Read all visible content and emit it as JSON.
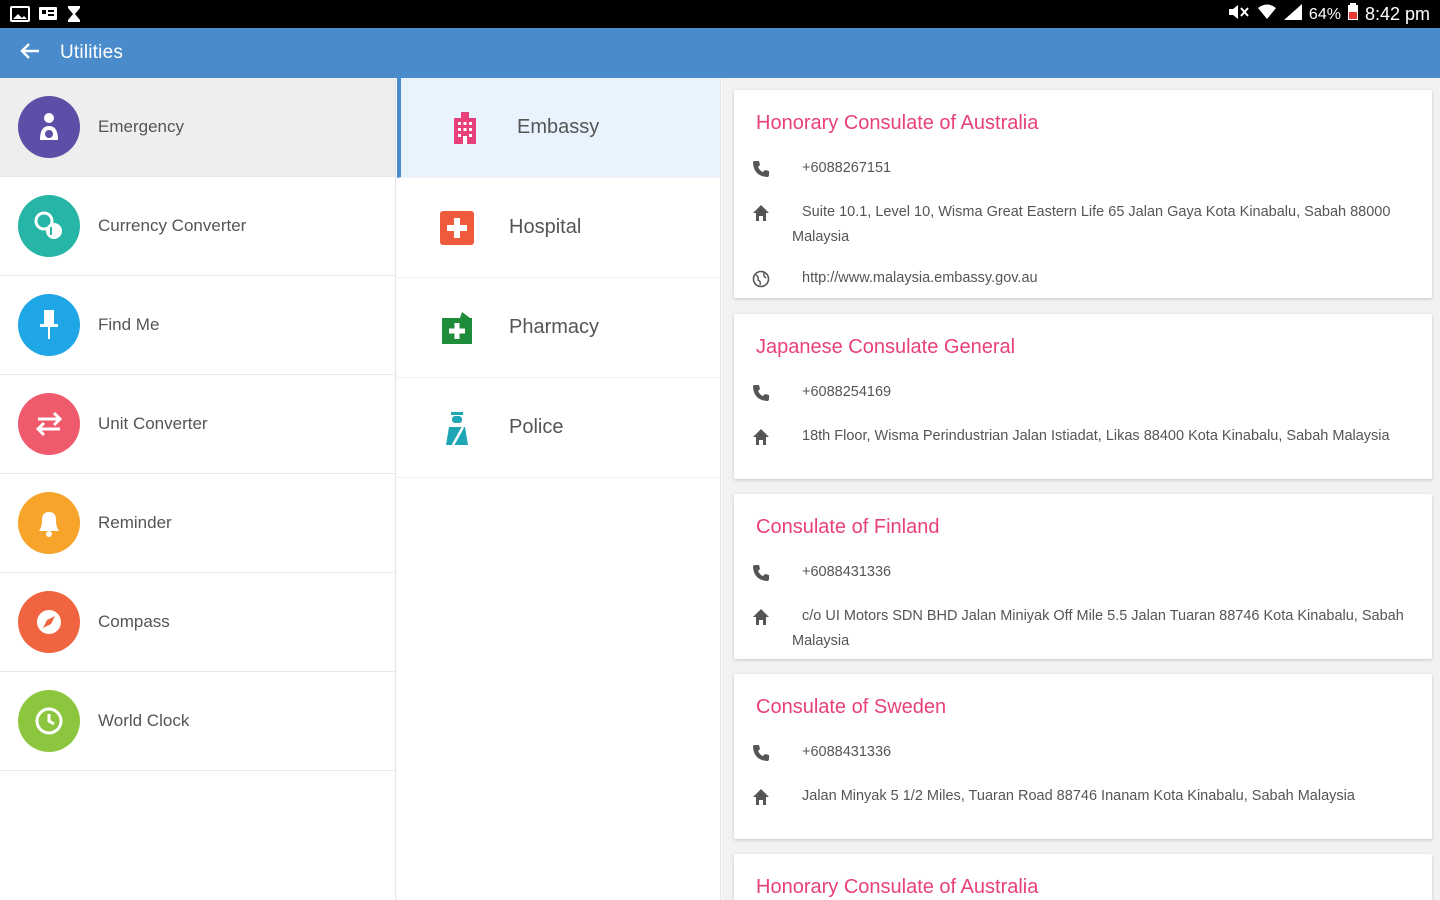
{
  "status_bar": {
    "left_icons": [
      "image-icon",
      "message-icon",
      "hourglass-icon"
    ],
    "battery": "64%",
    "time": "8:42 pm"
  },
  "toolbar": {
    "back_icon": "arrow-left-icon",
    "title": "Utilities"
  },
  "menu": [
    {
      "label": "Emergency",
      "icon": "emergency-icon",
      "color": "#5b4fa8"
    },
    {
      "label": "Currency Converter",
      "icon": "currency-icon",
      "color": "#26b5a6"
    },
    {
      "label": "Find Me",
      "icon": "pin-icon",
      "color": "#1fa6e6"
    },
    {
      "label": "Unit Converter",
      "icon": "swap-icon",
      "color": "#ef5a6c"
    },
    {
      "label": "Reminder",
      "icon": "bell-icon",
      "color": "#f7a52a"
    },
    {
      "label": "Compass",
      "icon": "compass-icon",
      "color": "#f0653f"
    },
    {
      "label": "World Clock",
      "icon": "clock-icon",
      "color": "#8cc63f"
    }
  ],
  "categories": [
    {
      "label": "Embassy",
      "icon": "building-icon",
      "color": "#e8407a"
    },
    {
      "label": "Hospital",
      "icon": "hospital-icon",
      "color": "#ef5a3c"
    },
    {
      "label": "Pharmacy",
      "icon": "pharmacy-icon",
      "color": "#1f8c3b"
    },
    {
      "label": "Police",
      "icon": "police-icon",
      "color": "#1fa6b6"
    }
  ],
  "entries": [
    {
      "name": "Honorary Consulate of Australia",
      "phone": "+6088267151",
      "address": "Suite 10.1, Level 10, Wisma Great Eastern Life 65 Jalan Gaya Kota Kinabalu, Sabah 88000 Malaysia",
      "website": "http://www.malaysia.embassy.gov.au"
    },
    {
      "name": "Japanese Consulate General",
      "phone": "+6088254169",
      "address": "18th Floor, Wisma Perindustrian Jalan Istiadat, Likas 88400 Kota Kinabalu, Sabah Malaysia"
    },
    {
      "name": "Consulate of Finland",
      "phone": "+6088431336",
      "address": "c/o UI Motors SDN BHD Jalan Miniyak Off Mile 5.5 Jalan Tuaran 88746 Kota Kinabalu, Sabah Malaysia"
    },
    {
      "name": "Consulate of Sweden",
      "phone": "+6088431336",
      "address": "Jalan Minyak 5 1/2 Miles, Tuaran Road 88746 Inanam Kota Kinabalu, Sabah Malaysia"
    },
    {
      "name": "Honorary Consulate of Australia"
    }
  ],
  "colors": {
    "toolbar": "#4a8ccb",
    "entry_title": "#e8407a",
    "selected_category_bg": "#e8f3fd"
  }
}
